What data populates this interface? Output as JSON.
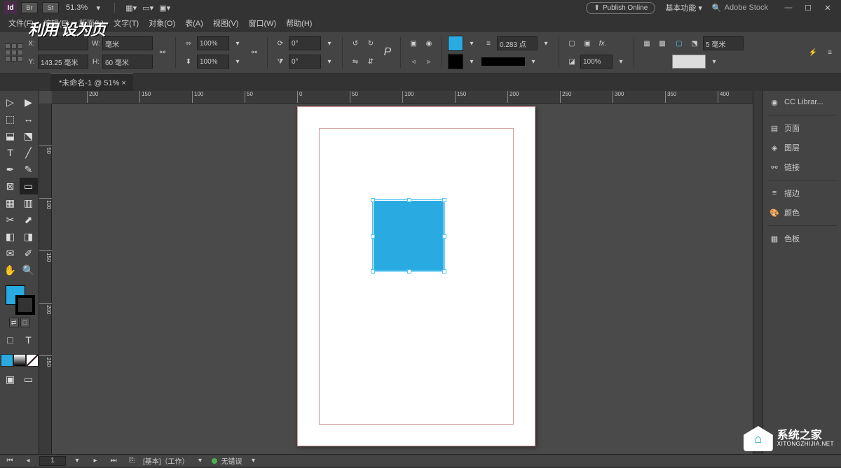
{
  "appbar": {
    "logo": "Id",
    "br": "Br",
    "st": "St",
    "zoom": "51.3%",
    "publish": "Publish Online",
    "workspace": "基本功能",
    "search": "Adobe Stock"
  },
  "menu": {
    "file": "文件(F)",
    "edit": "编辑(E)",
    "layout": "版面(L)",
    "type": "文字(T)",
    "object": "对象(O)",
    "table": "表(A)",
    "view": "视图(V)",
    "window": "窗口(W)",
    "help": "帮助(H)"
  },
  "blur_text": "利用     设为页",
  "ctrl": {
    "x_label": "X:",
    "y_label": "Y:",
    "w_label": "W:",
    "h_label": "H:",
    "x": "",
    "y": "143.25 毫米",
    "w": "毫米",
    "h": "60 毫米",
    "scale_x": "100%",
    "scale_y": "100%",
    "rotate": "0°",
    "shear": "0°",
    "p_icon": "P",
    "stroke_weight": "0.283 点",
    "opacity": "100%",
    "corner": "5 毫米"
  },
  "tab": {
    "name": "*未命名-1 @ 51% ×"
  },
  "ruler_h": [
    "200",
    "150",
    "100",
    "50",
    "0",
    "50",
    "100",
    "150",
    "200",
    "250",
    "300",
    "350",
    "400"
  ],
  "ruler_v": [
    "50",
    "100",
    "150",
    "200",
    "250"
  ],
  "panels": {
    "cc": "CC Librar...",
    "pages": "页面",
    "layers": "图层",
    "links": "链接",
    "stroke": "描边",
    "color": "颜色",
    "swatches": "色板"
  },
  "status": {
    "page": "1",
    "workspace": "[基本]（工作）",
    "errors": "无错误"
  },
  "watermark": {
    "cn": "系统之家",
    "en": "XITONGZHIJIA.NET"
  }
}
